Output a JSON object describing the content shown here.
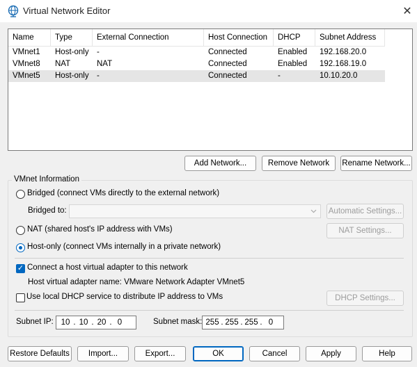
{
  "window": {
    "title": "Virtual Network Editor",
    "close_glyph": "✕"
  },
  "table": {
    "columns": [
      "Name",
      "Type",
      "External Connection",
      "Host Connection",
      "DHCP",
      "Subnet Address"
    ],
    "rows": [
      {
        "name": "VMnet1",
        "type": "Host-only",
        "external": "-",
        "host": "Connected",
        "dhcp": "Enabled",
        "subnet": "192.168.20.0"
      },
      {
        "name": "VMnet8",
        "type": "NAT",
        "external": "NAT",
        "host": "Connected",
        "dhcp": "Enabled",
        "subnet": "192.168.19.0"
      },
      {
        "name": "VMnet5",
        "type": "Host-only",
        "external": "-",
        "host": "Connected",
        "dhcp": "-",
        "subnet": "10.10.20.0"
      }
    ],
    "selected_row": 2
  },
  "network_buttons": {
    "add": "Add Network...",
    "remove": "Remove Network",
    "rename": "Rename Network..."
  },
  "vmnet_info": {
    "group_label": "VMnet Information",
    "bridged_label": "Bridged (connect VMs directly to the external network)",
    "bridged_to_label": "Bridged to:",
    "bridged_to_value": "",
    "automatic_settings": "Automatic Settings...",
    "nat_label": "NAT (shared host's IP address with VMs)",
    "nat_settings": "NAT Settings...",
    "hostonly_label": "Host-only (connect VMs internally in a private network)",
    "selected_mode": "host-only",
    "connect_adapter_label": "Connect a host virtual adapter to this network",
    "connect_adapter_checked": true,
    "adapter_name_text": "Host virtual adapter name: VMware Network Adapter VMnet5",
    "dhcp_label": "Use local DHCP service to distribute IP address to VMs",
    "dhcp_checked": false,
    "dhcp_settings": "DHCP Settings...",
    "subnet_ip_label": "Subnet IP:",
    "subnet_ip": [
      "10",
      "10",
      "20",
      "0"
    ],
    "subnet_mask_label": "Subnet mask:",
    "subnet_mask": [
      "255",
      "255",
      "255",
      "0"
    ]
  },
  "footer_buttons": {
    "restore": "Restore Defaults",
    "import": "Import...",
    "export": "Export...",
    "ok": "OK",
    "cancel": "Cancel",
    "apply": "Apply",
    "help": "Help"
  },
  "icons": {
    "app": "globe-network-icon",
    "close": "close-icon",
    "combo_arrow": "chevron-down-icon"
  },
  "colors": {
    "accent": "#0067c0",
    "selected_row": "#e5e5e5",
    "background": "#f0f0f0"
  }
}
